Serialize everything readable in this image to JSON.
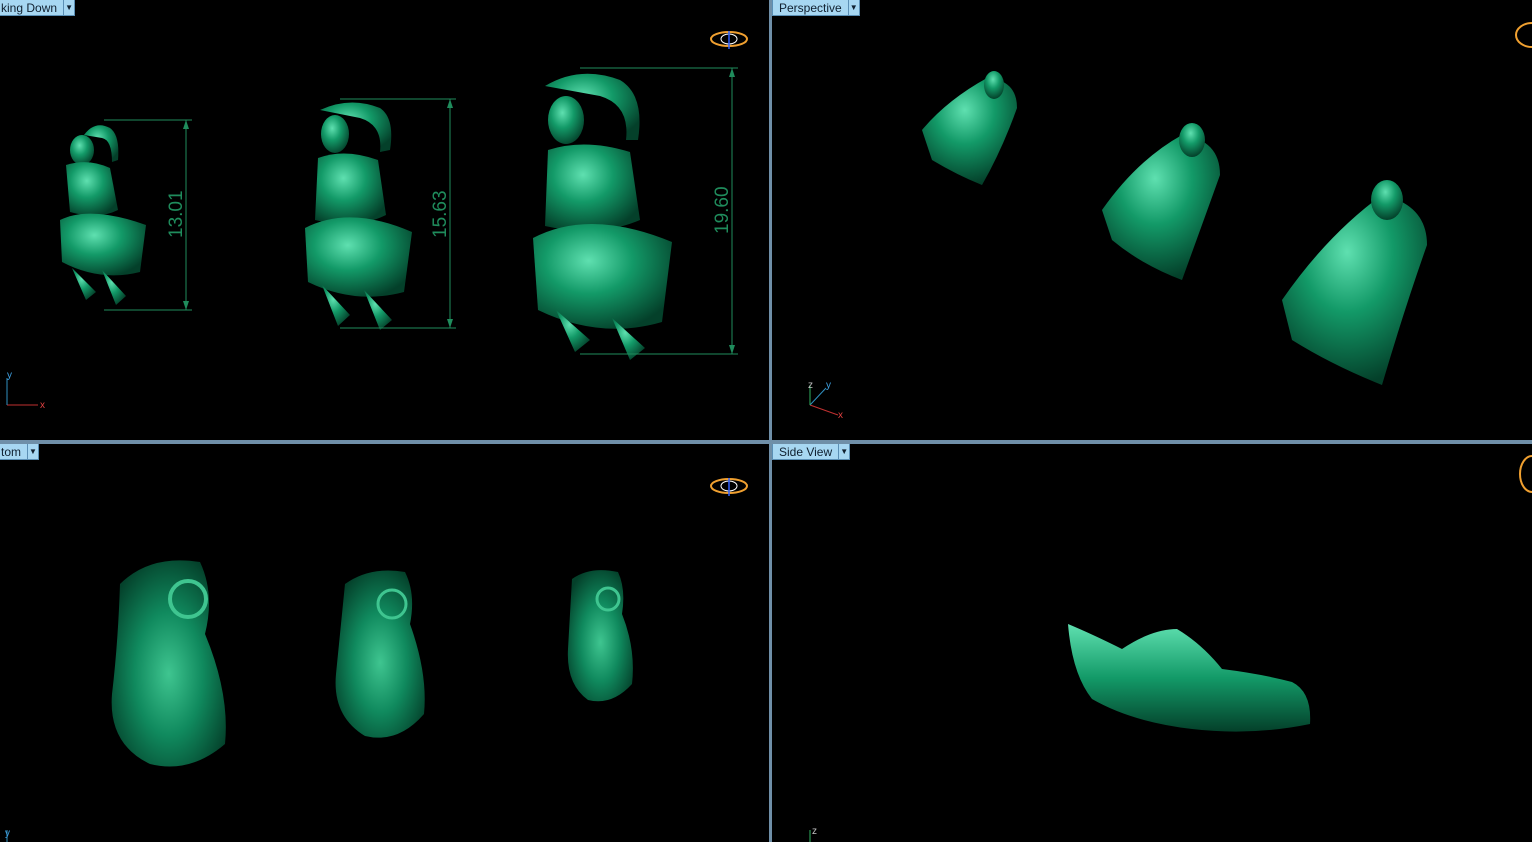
{
  "viewports": {
    "top": {
      "label": "king Down",
      "dimensions": [
        "13.01",
        "15.63",
        "19.60"
      ],
      "axes": {
        "x": "x",
        "y": "y"
      }
    },
    "perspective": {
      "label": "Perspective",
      "axes": {
        "x": "x",
        "y": "y",
        "z": "z"
      }
    },
    "bottom": {
      "label": "tom",
      "axes": {
        "y": "y"
      }
    },
    "side": {
      "label": "Side View",
      "axes": {
        "z": "z"
      }
    }
  },
  "colors": {
    "model": "#0f8a5e",
    "dimension": "#1f8c5c",
    "tab": "#a7d7f2",
    "separator": "#6f8fa8",
    "gumball": "#f0a030"
  },
  "icons": {
    "view-cube": "gumball-orbit-icon",
    "dropdown": "chevron-down-icon"
  }
}
